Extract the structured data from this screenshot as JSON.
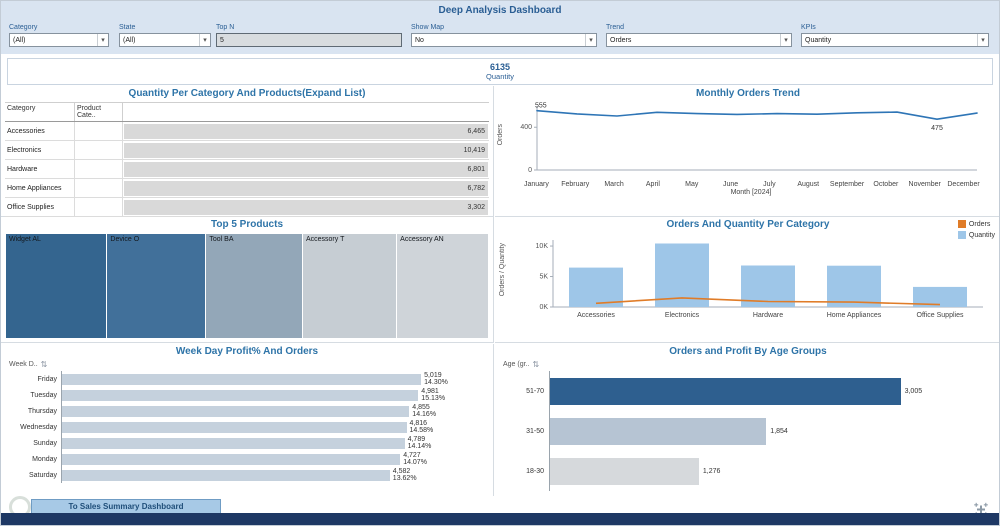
{
  "app": {
    "title": "Deep Analysis Dashboard"
  },
  "filters": [
    {
      "id": "category",
      "label": "Category",
      "type": "dropdown",
      "value": "(All)"
    },
    {
      "id": "state",
      "label": "State",
      "type": "dropdown",
      "value": "(All)"
    },
    {
      "id": "top_n",
      "label": "Top N",
      "type": "input",
      "value": "5"
    },
    {
      "id": "show_map",
      "label": "Show Map",
      "type": "dropdown",
      "value": "No"
    },
    {
      "id": "trend",
      "label": "Trend",
      "type": "dropdown",
      "value": "Orders"
    },
    {
      "id": "kpis",
      "label": "KPIs",
      "type": "dropdown",
      "value": "Quantity"
    }
  ],
  "kpi": {
    "value": "6135",
    "label": "Quantity"
  },
  "nav_button": {
    "label": "To Sales Summary Dashboard"
  },
  "chart_data": [
    {
      "id": "category_table",
      "type": "table",
      "title": "Quantity Per Category And Products(Expand List)",
      "columns": [
        "Category",
        "Product Cate.."
      ],
      "rows": [
        {
          "category": "Accessories",
          "value": 6465
        },
        {
          "category": "Electronics",
          "value": 10419
        },
        {
          "category": "Hardware",
          "value": 6801
        },
        {
          "category": "Home Appliances",
          "value": 6782
        },
        {
          "category": "Office Supplies",
          "value": 3302
        }
      ]
    },
    {
      "id": "monthly_trend",
      "type": "line",
      "title": "Monthly Orders Trend",
      "ylabel": "Orders",
      "xlabel": "Month [2024]",
      "x": [
        "January",
        "February",
        "March",
        "April",
        "May",
        "June",
        "July",
        "August",
        "September",
        "October",
        "November",
        "December"
      ],
      "values": [
        555,
        525,
        505,
        540,
        528,
        520,
        528,
        522,
        535,
        542,
        475,
        532
      ],
      "ylim": [
        0,
        580
      ],
      "yticks": [
        {
          "label": "0",
          "value": 0
        },
        {
          "label": "400",
          "value": 400
        }
      ],
      "annotations": [
        {
          "index": 0,
          "text": "555"
        },
        {
          "index": 10,
          "text": "475"
        }
      ],
      "color": "#2e75b6"
    },
    {
      "id": "top_products",
      "type": "treemap",
      "title": "Top 5 Products",
      "items": [
        {
          "label": "Widget AL",
          "share": 21,
          "color": "#34658f"
        },
        {
          "label": "Device O",
          "share": 20.5,
          "color": "#41709a"
        },
        {
          "label": "Tool BA",
          "share": 20,
          "color": "#93a7b8"
        },
        {
          "label": "Accessory T",
          "share": 19.5,
          "color": "#c6cdd3"
        },
        {
          "label": "Accessory AN",
          "share": 19,
          "color": "#cfd4d9"
        }
      ]
    },
    {
      "id": "orders_quantity",
      "type": "bar-line",
      "title": "Orders And Quantity Per Category",
      "ylabel": "Orders / Quantity",
      "categories": [
        "Accessories",
        "Electronics",
        "Hardware",
        "Home Appliances",
        "Office Supplies"
      ],
      "series": [
        {
          "name": "Orders",
          "kind": "line",
          "color": "#e07c28",
          "values": [
            600,
            1500,
            900,
            800,
            400
          ]
        },
        {
          "name": "Quantity",
          "kind": "bar",
          "color": "#9ec6e8",
          "values": [
            6465,
            10419,
            6801,
            6782,
            3302
          ]
        }
      ],
      "ylim": [
        0,
        10500
      ],
      "yticks": [
        {
          "label": "0K",
          "value": 0
        },
        {
          "label": "5K",
          "value": 5000
        },
        {
          "label": "10K",
          "value": 10000
        }
      ]
    },
    {
      "id": "weekday",
      "type": "hbar",
      "title": "Week Day Profit% And Orders",
      "col_header": "Week D..",
      "categories": [
        "Friday",
        "Tuesday",
        "Thursday",
        "Wednesday",
        "Sunday",
        "Monday",
        "Saturday"
      ],
      "values": [
        5019,
        4981,
        4855,
        4816,
        4789,
        4727,
        4582
      ],
      "percent_labels": [
        "14.30%",
        "15.13%",
        "14.16%",
        "14.58%",
        "14.14%",
        "14.07%",
        "13.62%"
      ],
      "bar_color": "#c5d1dd",
      "xlim": [
        0,
        5200
      ]
    },
    {
      "id": "age_groups",
      "type": "hbar",
      "title": "Orders and Profit By Age Groups",
      "col_header": "Age (gr..",
      "categories": [
        "51-70",
        "31-50",
        "18-30"
      ],
      "values": [
        3005,
        1854,
        1276
      ],
      "bar_colors": [
        "#2e5f8f",
        "#b6c4d3",
        "#d6d9dc"
      ],
      "xlim": [
        0,
        3300
      ]
    }
  ]
}
